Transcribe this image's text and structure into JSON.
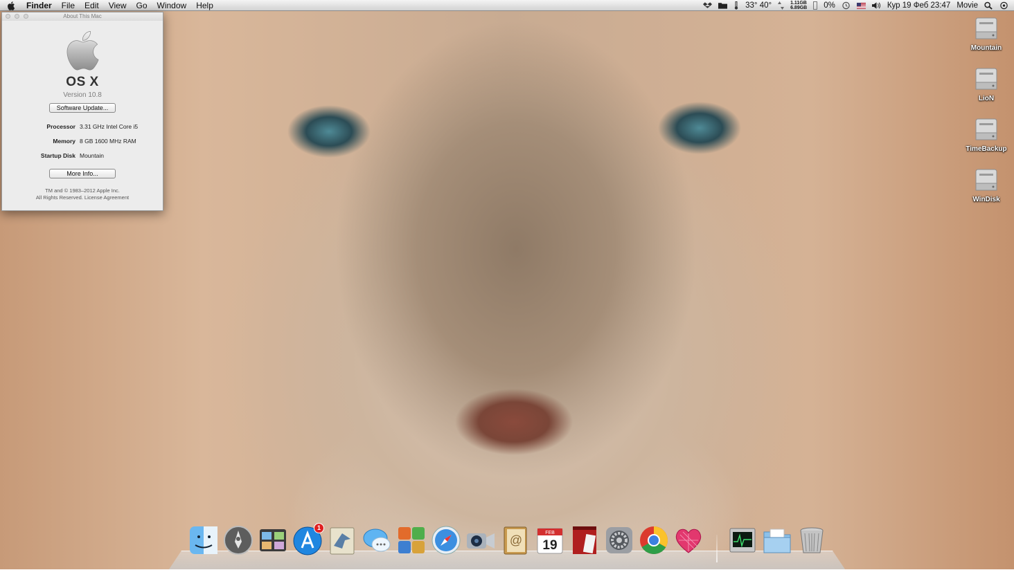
{
  "menubar": {
    "apple_menu": "apple-icon",
    "app_name": "Finder",
    "menus": [
      "File",
      "Edit",
      "View",
      "Go",
      "Window",
      "Help"
    ],
    "status": {
      "temperatures": "33° 40°",
      "memory_top": "1.11GB",
      "memory_bottom": "6.89GB",
      "cpu": "0%",
      "datetime": "Кур 19 Феб 23:47",
      "user": "Movie"
    }
  },
  "about_window": {
    "title": "About This Mac",
    "os_name": "OS X",
    "version": "Version 10.8",
    "software_update_label": "Software Update...",
    "specs": [
      {
        "label": "Processor",
        "value": "3.31 GHz Intel Core i5"
      },
      {
        "label": "Memory",
        "value": "8 GB 1600 MHz RAM"
      },
      {
        "label": "Startup Disk",
        "value": "Mountain"
      }
    ],
    "more_info_label": "More Info...",
    "legal_line1": "TM and © 1983–2012 Apple Inc.",
    "legal_line2": "All Rights Reserved.  License Agreement"
  },
  "desktop_icons": [
    {
      "name": "Mountain"
    },
    {
      "name": "LioN"
    },
    {
      "name": "TimeBackup"
    },
    {
      "name": "WinDisk"
    }
  ],
  "dock": {
    "items": [
      {
        "icon": "finder-icon"
      },
      {
        "icon": "launchpad-icon"
      },
      {
        "icon": "photo-browser-icon"
      },
      {
        "icon": "app-store-icon",
        "badge": "1"
      },
      {
        "icon": "mail-icon"
      },
      {
        "icon": "messages-icon"
      },
      {
        "icon": "utilities-icon"
      },
      {
        "icon": "safari-icon"
      },
      {
        "icon": "facetime-icon"
      },
      {
        "icon": "contacts-icon"
      },
      {
        "icon": "calendar-icon",
        "calendar_month": "FEB",
        "calendar_day": "19"
      },
      {
        "icon": "photo-booth-icon"
      },
      {
        "icon": "system-preferences-icon"
      },
      {
        "icon": "chrome-icon"
      },
      {
        "icon": "heart-app-icon"
      },
      {
        "icon": "activity-monitor-icon"
      },
      {
        "icon": "documents-folder-icon"
      },
      {
        "icon": "trash-icon"
      }
    ]
  },
  "colors": {
    "menubar_bg": "#dcdcdc",
    "window_bg": "#ececec",
    "badge_red": "#e02020"
  }
}
